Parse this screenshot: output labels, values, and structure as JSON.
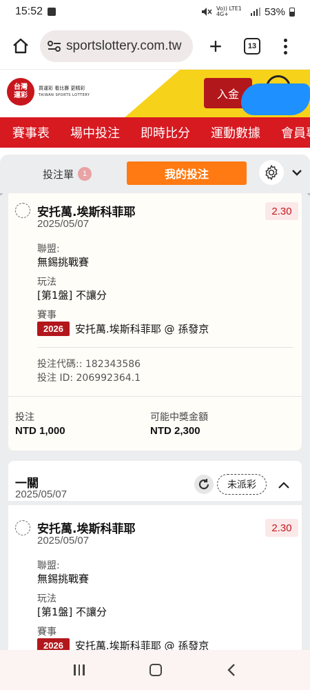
{
  "status_bar": {
    "time": "15:52",
    "network": "Vo)) LTE1 4G+",
    "battery": "53%"
  },
  "browser": {
    "url": "sportslottery.com.tw",
    "tab_count": "13"
  },
  "site": {
    "logo_line1": "台灣",
    "logo_line2": "運彩",
    "logo_tagline": "買運彩 看比賽 更精彩",
    "logo_tagline_en": "TAIWAN SPORTS LOTTERY",
    "deposit_label": "入金"
  },
  "nav": {
    "items": [
      "賽事表",
      "場中投注",
      "即時比分",
      "運動數據",
      "會員專區"
    ]
  },
  "panel": {
    "slip_label": "投注單",
    "slip_count": "1",
    "my_bets_label": "我的投注"
  },
  "bet_1": {
    "selection": "安托萬.埃斯科菲耶",
    "date": "2025/05/07",
    "odds": "2.30",
    "league_label": "聯盟:",
    "league": "無錫挑戰賽",
    "market_label": "玩法",
    "market": "[第1盤] 不讓分",
    "event_label": "賽事",
    "event_code": "2026",
    "event_name": "安托萬.埃斯科菲耶 @ 孫發京",
    "bet_code": "投注代碼:: 182343586",
    "bet_id": "投注 ID: 206992364.1",
    "stake_label": "投注",
    "stake": "NTD 1,000",
    "payout_label": "可能中獎金額",
    "payout": "NTD 2,300"
  },
  "group_2": {
    "title": "一關",
    "date": "2025/05/07",
    "status": "未派彩"
  },
  "bet_2": {
    "selection": "安托萬.埃斯科菲耶",
    "date": "2025/05/07",
    "odds": "2.30",
    "league_label": "聯盟:",
    "league": "無錫挑戰賽",
    "market_label": "玩法",
    "market": "[第1盤] 不讓分",
    "event_label": "賽事",
    "event_code": "2026",
    "event_name": "安托萬.埃斯科菲耶 @ 孫發京"
  },
  "colors": {
    "brand_red": "#d71920",
    "accent_orange": "#ff7a12",
    "odds_red": "#c8161d",
    "yellow": "#f7d21a"
  }
}
